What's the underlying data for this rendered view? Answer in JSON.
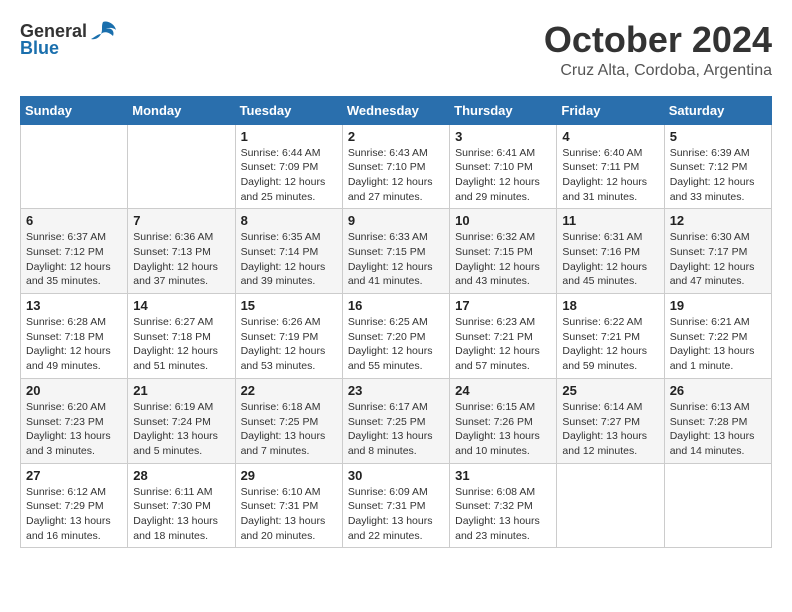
{
  "header": {
    "logo_general": "General",
    "logo_blue": "Blue",
    "month_title": "October 2024",
    "location": "Cruz Alta, Cordoba, Argentina"
  },
  "calendar": {
    "weekdays": [
      "Sunday",
      "Monday",
      "Tuesday",
      "Wednesday",
      "Thursday",
      "Friday",
      "Saturday"
    ],
    "weeks": [
      [
        {
          "day": "",
          "info": ""
        },
        {
          "day": "",
          "info": ""
        },
        {
          "day": "1",
          "info": "Sunrise: 6:44 AM\nSunset: 7:09 PM\nDaylight: 12 hours and 25 minutes."
        },
        {
          "day": "2",
          "info": "Sunrise: 6:43 AM\nSunset: 7:10 PM\nDaylight: 12 hours and 27 minutes."
        },
        {
          "day": "3",
          "info": "Sunrise: 6:41 AM\nSunset: 7:10 PM\nDaylight: 12 hours and 29 minutes."
        },
        {
          "day": "4",
          "info": "Sunrise: 6:40 AM\nSunset: 7:11 PM\nDaylight: 12 hours and 31 minutes."
        },
        {
          "day": "5",
          "info": "Sunrise: 6:39 AM\nSunset: 7:12 PM\nDaylight: 12 hours and 33 minutes."
        }
      ],
      [
        {
          "day": "6",
          "info": "Sunrise: 6:37 AM\nSunset: 7:12 PM\nDaylight: 12 hours and 35 minutes."
        },
        {
          "day": "7",
          "info": "Sunrise: 6:36 AM\nSunset: 7:13 PM\nDaylight: 12 hours and 37 minutes."
        },
        {
          "day": "8",
          "info": "Sunrise: 6:35 AM\nSunset: 7:14 PM\nDaylight: 12 hours and 39 minutes."
        },
        {
          "day": "9",
          "info": "Sunrise: 6:33 AM\nSunset: 7:15 PM\nDaylight: 12 hours and 41 minutes."
        },
        {
          "day": "10",
          "info": "Sunrise: 6:32 AM\nSunset: 7:15 PM\nDaylight: 12 hours and 43 minutes."
        },
        {
          "day": "11",
          "info": "Sunrise: 6:31 AM\nSunset: 7:16 PM\nDaylight: 12 hours and 45 minutes."
        },
        {
          "day": "12",
          "info": "Sunrise: 6:30 AM\nSunset: 7:17 PM\nDaylight: 12 hours and 47 minutes."
        }
      ],
      [
        {
          "day": "13",
          "info": "Sunrise: 6:28 AM\nSunset: 7:18 PM\nDaylight: 12 hours and 49 minutes."
        },
        {
          "day": "14",
          "info": "Sunrise: 6:27 AM\nSunset: 7:18 PM\nDaylight: 12 hours and 51 minutes."
        },
        {
          "day": "15",
          "info": "Sunrise: 6:26 AM\nSunset: 7:19 PM\nDaylight: 12 hours and 53 minutes."
        },
        {
          "day": "16",
          "info": "Sunrise: 6:25 AM\nSunset: 7:20 PM\nDaylight: 12 hours and 55 minutes."
        },
        {
          "day": "17",
          "info": "Sunrise: 6:23 AM\nSunset: 7:21 PM\nDaylight: 12 hours and 57 minutes."
        },
        {
          "day": "18",
          "info": "Sunrise: 6:22 AM\nSunset: 7:21 PM\nDaylight: 12 hours and 59 minutes."
        },
        {
          "day": "19",
          "info": "Sunrise: 6:21 AM\nSunset: 7:22 PM\nDaylight: 13 hours and 1 minute."
        }
      ],
      [
        {
          "day": "20",
          "info": "Sunrise: 6:20 AM\nSunset: 7:23 PM\nDaylight: 13 hours and 3 minutes."
        },
        {
          "day": "21",
          "info": "Sunrise: 6:19 AM\nSunset: 7:24 PM\nDaylight: 13 hours and 5 minutes."
        },
        {
          "day": "22",
          "info": "Sunrise: 6:18 AM\nSunset: 7:25 PM\nDaylight: 13 hours and 7 minutes."
        },
        {
          "day": "23",
          "info": "Sunrise: 6:17 AM\nSunset: 7:25 PM\nDaylight: 13 hours and 8 minutes."
        },
        {
          "day": "24",
          "info": "Sunrise: 6:15 AM\nSunset: 7:26 PM\nDaylight: 13 hours and 10 minutes."
        },
        {
          "day": "25",
          "info": "Sunrise: 6:14 AM\nSunset: 7:27 PM\nDaylight: 13 hours and 12 minutes."
        },
        {
          "day": "26",
          "info": "Sunrise: 6:13 AM\nSunset: 7:28 PM\nDaylight: 13 hours and 14 minutes."
        }
      ],
      [
        {
          "day": "27",
          "info": "Sunrise: 6:12 AM\nSunset: 7:29 PM\nDaylight: 13 hours and 16 minutes."
        },
        {
          "day": "28",
          "info": "Sunrise: 6:11 AM\nSunset: 7:30 PM\nDaylight: 13 hours and 18 minutes."
        },
        {
          "day": "29",
          "info": "Sunrise: 6:10 AM\nSunset: 7:31 PM\nDaylight: 13 hours and 20 minutes."
        },
        {
          "day": "30",
          "info": "Sunrise: 6:09 AM\nSunset: 7:31 PM\nDaylight: 13 hours and 22 minutes."
        },
        {
          "day": "31",
          "info": "Sunrise: 6:08 AM\nSunset: 7:32 PM\nDaylight: 13 hours and 23 minutes."
        },
        {
          "day": "",
          "info": ""
        },
        {
          "day": "",
          "info": ""
        }
      ]
    ]
  }
}
